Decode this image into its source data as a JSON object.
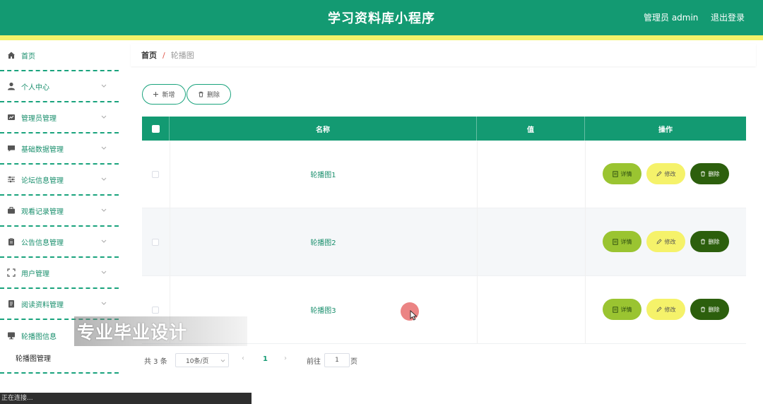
{
  "header": {
    "title": "学习资料库小程序",
    "admin": "管理员 admin",
    "logout": "退出登录",
    "bg_color": "#139a72",
    "strip_color": "#f2f26a"
  },
  "sidebar": {
    "items": [
      {
        "label": "首页",
        "icon": "home-icon"
      },
      {
        "label": "个人中心",
        "icon": "user-icon"
      },
      {
        "label": "管理员管理",
        "icon": "admin-card-icon"
      },
      {
        "label": "基础数据管理",
        "icon": "message-icon"
      },
      {
        "label": "论坛信息管理",
        "icon": "sliders-icon"
      },
      {
        "label": "观看记录管理",
        "icon": "briefcase-icon"
      },
      {
        "label": "公告信息管理",
        "icon": "clipboard-icon"
      },
      {
        "label": "用户管理",
        "icon": "scan-frame-icon"
      },
      {
        "label": "阅读资料管理",
        "icon": "document-icon"
      },
      {
        "label": "轮播图信息",
        "icon": "monitor-icon"
      }
    ],
    "sub_item": "轮播图管理"
  },
  "breadcrumb": {
    "home": "首页",
    "current": "轮播图"
  },
  "toolbar": {
    "add": "新增",
    "delete": "删除"
  },
  "table": {
    "columns": [
      "名称",
      "值",
      "操作"
    ],
    "rows": [
      {
        "name": "轮播图1",
        "value": ""
      },
      {
        "name": "轮播图2",
        "value": ""
      },
      {
        "name": "轮播图3",
        "value": ""
      }
    ],
    "actions": {
      "detail": "详情",
      "edit": "修改",
      "delete": "删除"
    }
  },
  "pagination": {
    "total": "共 3 条",
    "page_size": "10条/页",
    "current_page": "1",
    "goto_label": "前往",
    "goto_value": "1",
    "page_unit": "页"
  },
  "watermark": "专业毕业设计",
  "statusbar": "正在连接..."
}
